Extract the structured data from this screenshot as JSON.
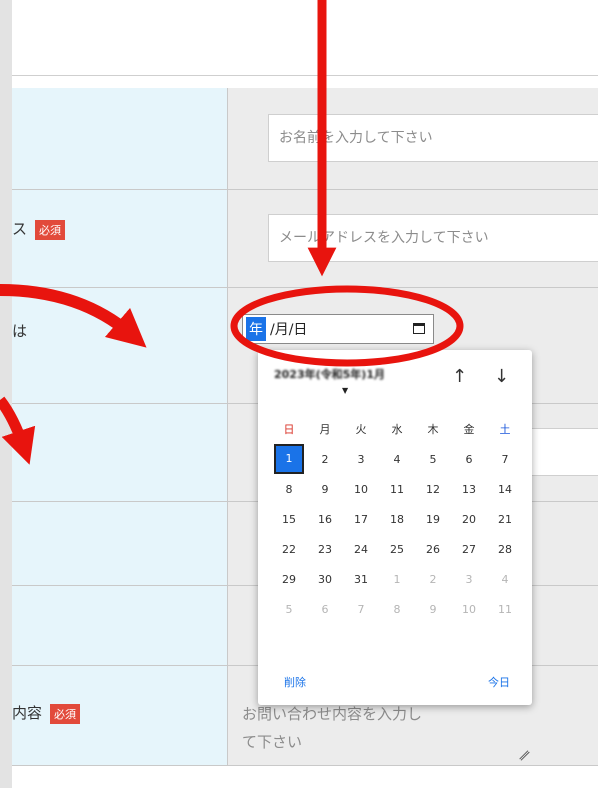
{
  "form": {
    "name_placeholder": "お名前を入力して下さい",
    "email_label": "ス",
    "email_required": "必須",
    "email_placeholder": "メールアドレスを入力して下さい",
    "date_label": "は",
    "inquiry_label": "内容",
    "inquiry_required": "必須",
    "inquiry_placeholder_line1": "お問い合わせ内容を入力し",
    "inquiry_placeholder_line2": "て下さい"
  },
  "date_input": {
    "year_segment": "年",
    "rest_segments": "/月/日"
  },
  "calendar": {
    "month_label": "2023年(令和5年)1月",
    "prev_label": "↑",
    "next_label": "↓",
    "weekdays": [
      "日",
      "月",
      "火",
      "水",
      "木",
      "金",
      "土"
    ],
    "weeks": [
      [
        "1",
        "2",
        "3",
        "4",
        "5",
        "6",
        "7"
      ],
      [
        "8",
        "9",
        "10",
        "11",
        "12",
        "13",
        "14"
      ],
      [
        "15",
        "16",
        "17",
        "18",
        "19",
        "20",
        "21"
      ],
      [
        "22",
        "23",
        "24",
        "25",
        "26",
        "27",
        "28"
      ],
      [
        "29",
        "30",
        "31",
        "1",
        "2",
        "3",
        "4"
      ],
      [
        "5",
        "6",
        "7",
        "8",
        "9",
        "10",
        "11"
      ]
    ],
    "selected": "1",
    "clear_label": "削除",
    "today_label": "今日"
  },
  "colors": {
    "accent": "#1a73e8",
    "annotation": "#e8140e",
    "label_bg": "#e6f5fb",
    "required_badge": "#e24a3b"
  }
}
